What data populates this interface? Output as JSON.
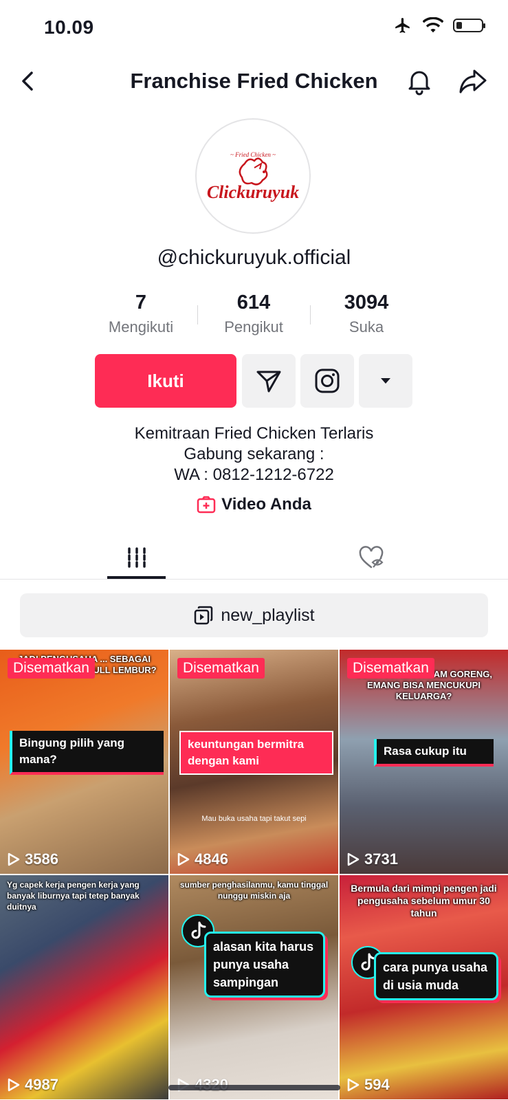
{
  "status_bar": {
    "time": "10.09"
  },
  "header": {
    "title": "Franchise Fried Chicken"
  },
  "profile": {
    "username": "@chickuruyuk.official",
    "logo_text": "Chickuruyuk",
    "logo_small": "Fried Chicken",
    "stats": [
      {
        "value": "7",
        "label": "Mengikuti"
      },
      {
        "value": "614",
        "label": "Pengikut"
      },
      {
        "value": "3094",
        "label": "Suka"
      }
    ],
    "follow_label": "Ikuti",
    "bio_lines": [
      "Kemitraan Fried Chicken Terlaris",
      "Gabung sekarang :",
      "WA : 0812-1212-6722"
    ],
    "video_anda": "Video Anda"
  },
  "playlist": {
    "label": "new_playlist"
  },
  "videos": [
    {
      "pinned": "Disematkan",
      "views": "3586",
      "top_text": "JADI PENGUSAHA ... SEBAGAI KARYAWAN TAPI FULL LEMBUR?",
      "caption": "Bingung pilih yang mana?"
    },
    {
      "pinned": "Disematkan",
      "views": "4846",
      "caption": "keuntungan bermitra dengan kami",
      "sub_text": "Mau buka usaha tapi takut sepi"
    },
    {
      "pinned": "Disematkan",
      "views": "3731",
      "top_text": "CUMA JUALAN AYAM GORENG, EMANG BISA MENCUKUPI KELUARGA?",
      "caption": "Rasa cukup itu"
    },
    {
      "views": "4987",
      "top_text": "Yg capek kerja pengen kerja yang banyak liburnya tapi tetep banyak duitnya"
    },
    {
      "views": "4320",
      "top_text": "sumber penghasilanmu, kamu tinggal nunggu miskin aja",
      "caption": "alasan kita harus punya usaha sampingan"
    },
    {
      "views": "594",
      "top_text": "Bermula dari mimpi pengen jadi pengusaha sebelum umur 30 tahun",
      "caption": "cara punya usaha di usia muda"
    }
  ],
  "colors": {
    "accent": "#fe2c55",
    "text": "#161823",
    "muted": "#73757b",
    "button_bg": "#f1f1f2"
  },
  "icons": [
    "back-icon",
    "bell-icon",
    "share-icon",
    "send-icon",
    "instagram-icon",
    "dropdown-icon",
    "video-plus-icon",
    "grid-tab-icon",
    "liked-hidden-icon",
    "playlist-icon",
    "play-icon",
    "tiktok-icon"
  ]
}
